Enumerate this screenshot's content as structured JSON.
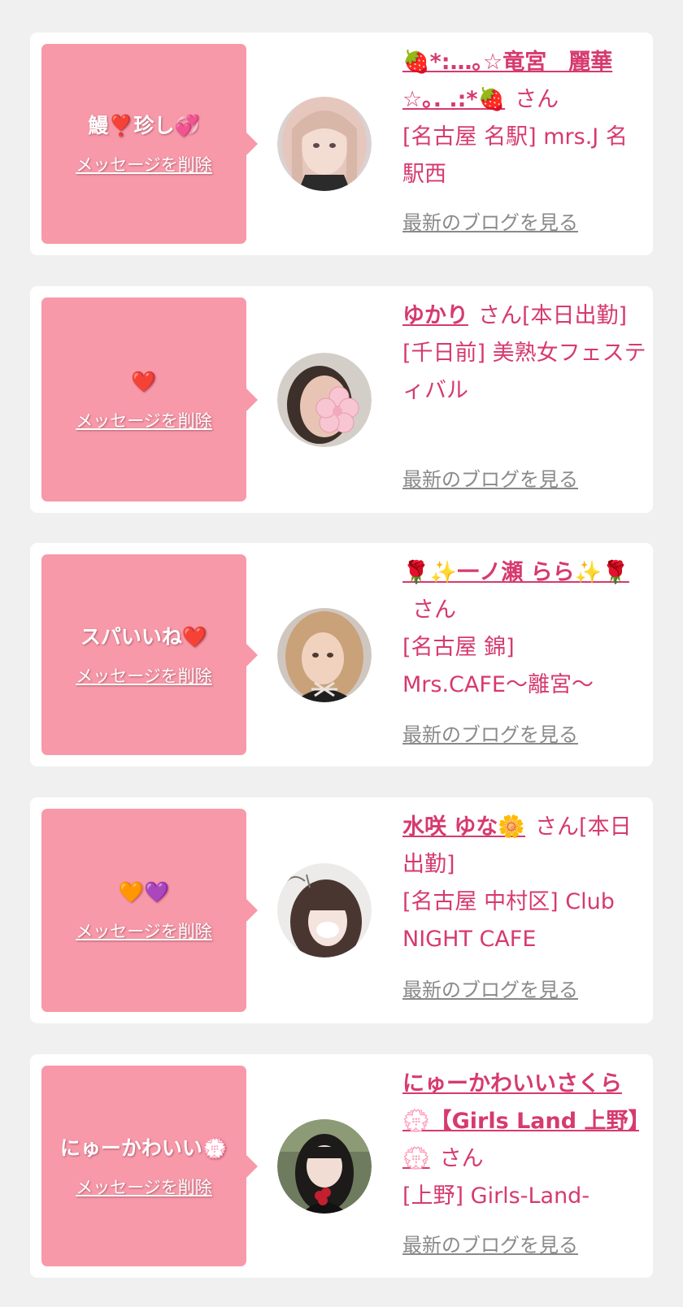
{
  "colors": {
    "page_bg": "#f0f0f0",
    "card_bg": "#ffffff",
    "bubble_bg": "#f799a9",
    "name_color": "#d63a6e",
    "link_gray": "#8a8a8a"
  },
  "items": [
    {
      "message": "鰻❣️珍し💞",
      "delete_label": "メッセージを削除",
      "name": "🍓*:…｡☆竜宮　麗華☆｡. .:*🍓",
      "honorific": "さん",
      "shop": "[名古屋 名駅] mrs.J 名駅西",
      "blog_link": "最新のブログを見る",
      "avatar_icon": "profile-photo-blonde"
    },
    {
      "message": "❤️",
      "delete_label": "メッセージを削除",
      "name": "ゆかり",
      "honorific": "さん[本日出勤]",
      "shop": "[千日前] 美熟女フェスティバル",
      "blog_link": "最新のブログを見る",
      "avatar_icon": "profile-photo-sakura-sticker"
    },
    {
      "message": "スパいいね❤️",
      "delete_label": "メッセージを削除",
      "name": "🌹✨一ノ瀬 らら✨🌹",
      "honorific": "さん",
      "shop": "[名古屋 錦] Mrs.CAFE〜離宮〜",
      "blog_link": "最新のブログを見る",
      "avatar_icon": "profile-photo-blonde-curls"
    },
    {
      "message": "🧡💜",
      "delete_label": "メッセージを削除",
      "name": "水咲 ゆな🌼",
      "honorific": "さん[本日出勤]",
      "shop": "[名古屋 中村区] Club NIGHT CAFE",
      "blog_link": "最新のブログを見る",
      "avatar_icon": "profile-photo-brunette"
    },
    {
      "message": "にゅーかわいい💮",
      "delete_label": "メッセージを削除",
      "name": "にゅーかわいいさくら💮【Girls Land 上野】💮",
      "honorific": "さん",
      "shop": "[上野] Girls-Land-",
      "blog_link": "最新のブログを見る",
      "avatar_icon": "profile-photo-black-hair"
    }
  ]
}
